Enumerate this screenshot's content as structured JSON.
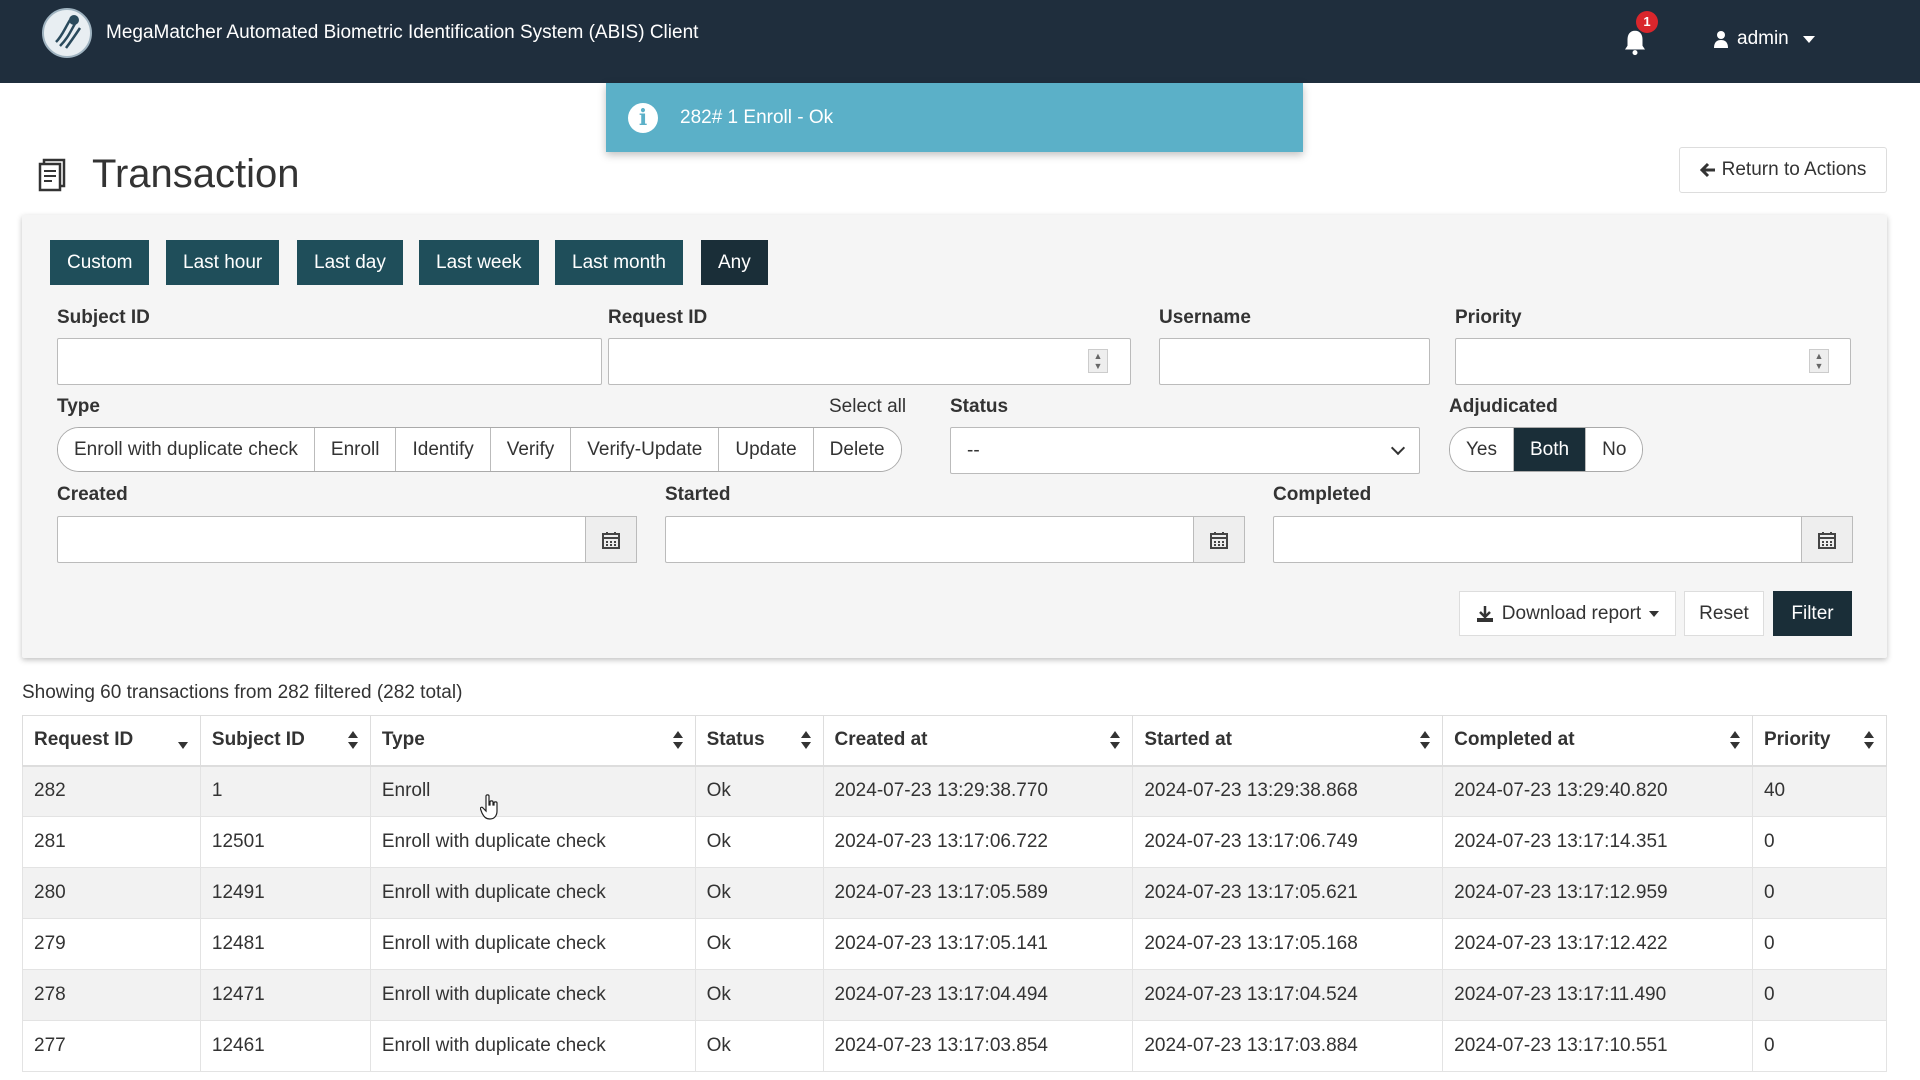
{
  "app": {
    "title": "MegaMatcher Automated Biometric Identification System (ABIS) Client",
    "notification_count": "1",
    "user": "admin"
  },
  "toast": {
    "message": "282# 1 Enroll - Ok"
  },
  "page": {
    "title": "Transaction",
    "return_label": "Return to Actions"
  },
  "filters": {
    "ranges": [
      "Custom",
      "Last hour",
      "Last day",
      "Last week",
      "Last month",
      "Any"
    ],
    "active_range": "Any",
    "subject_id_label": "Subject ID",
    "subject_id_value": "",
    "request_id_label": "Request ID",
    "request_id_value": "",
    "username_label": "Username",
    "username_value": "",
    "priority_label": "Priority",
    "priority_value": "",
    "type_label": "Type",
    "select_all_label": "Select all",
    "types": [
      "Enroll with duplicate check",
      "Enroll",
      "Identify",
      "Verify",
      "Verify-Update",
      "Update",
      "Delete"
    ],
    "status_label": "Status",
    "status_value": "--",
    "adjudicated_label": "Adjudicated",
    "adjudicated_options": [
      "Yes",
      "Both",
      "No"
    ],
    "adjudicated_selected": "Both",
    "created_label": "Created",
    "started_label": "Started",
    "completed_label": "Completed",
    "download_label": "Download report",
    "reset_label": "Reset",
    "filter_label": "Filter"
  },
  "table": {
    "summary": "Showing 60 transactions from 282 filtered (282 total)",
    "columns": [
      "Request ID",
      "Subject ID",
      "Type",
      "Status",
      "Created at",
      "Started at",
      "Completed at",
      "Priority"
    ],
    "rows": [
      [
        "282",
        "1",
        "Enroll",
        "Ok",
        "2024-07-23 13:29:38.770",
        "2024-07-23 13:29:38.868",
        "2024-07-23 13:29:40.820",
        "40"
      ],
      [
        "281",
        "12501",
        "Enroll with duplicate check",
        "Ok",
        "2024-07-23 13:17:06.722",
        "2024-07-23 13:17:06.749",
        "2024-07-23 13:17:14.351",
        "0"
      ],
      [
        "280",
        "12491",
        "Enroll with duplicate check",
        "Ok",
        "2024-07-23 13:17:05.589",
        "2024-07-23 13:17:05.621",
        "2024-07-23 13:17:12.959",
        "0"
      ],
      [
        "279",
        "12481",
        "Enroll with duplicate check",
        "Ok",
        "2024-07-23 13:17:05.141",
        "2024-07-23 13:17:05.168",
        "2024-07-23 13:17:12.422",
        "0"
      ],
      [
        "278",
        "12471",
        "Enroll with duplicate check",
        "Ok",
        "2024-07-23 13:17:04.494",
        "2024-07-23 13:17:04.524",
        "2024-07-23 13:17:11.490",
        "0"
      ],
      [
        "277",
        "12461",
        "Enroll with duplicate check",
        "Ok",
        "2024-07-23 13:17:03.854",
        "2024-07-23 13:17:03.884",
        "2024-07-23 13:17:10.551",
        "0"
      ]
    ]
  },
  "colors": {
    "navbar": "#1f2e3d",
    "toast": "#5bb0c8",
    "range_button": "#1f4e5a",
    "active_dark": "#1a2e38"
  },
  "icons": [
    "logo-icon",
    "bell-icon",
    "user-icon",
    "info-icon",
    "document-icon",
    "arrow-left-icon",
    "calendar-icon",
    "download-icon",
    "sort-icon",
    "hand-cursor-icon"
  ]
}
